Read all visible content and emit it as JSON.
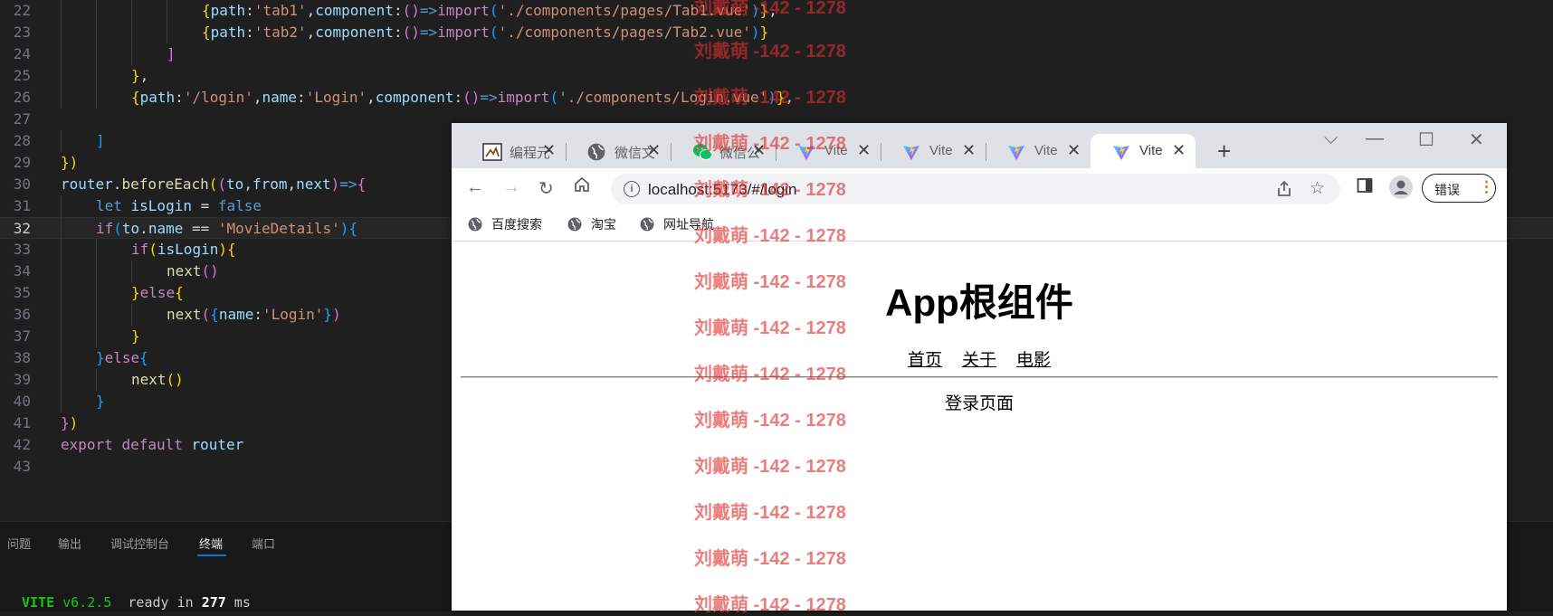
{
  "editor": {
    "lines": [
      {
        "n": "22",
        "active": false,
        "indent": 4,
        "tokens": [
          [
            "{",
            "b1"
          ],
          [
            "path",
            "key"
          ],
          [
            ":",
            "punc"
          ],
          [
            "'tab1'",
            "str"
          ],
          [
            ",",
            "punc"
          ],
          [
            "component",
            "key"
          ],
          [
            ":",
            "punc"
          ],
          [
            "()",
            "b2"
          ],
          [
            "=>",
            "kw"
          ],
          [
            "import",
            "ctl"
          ],
          [
            "(",
            "b3"
          ],
          [
            "'./components/pages/Tab1.vue'",
            "str"
          ],
          [
            ")",
            "b3"
          ],
          [
            "}",
            "b1"
          ],
          [
            ",",
            "punc"
          ]
        ]
      },
      {
        "n": "23",
        "active": false,
        "indent": 4,
        "tokens": [
          [
            "{",
            "b1"
          ],
          [
            "path",
            "key"
          ],
          [
            ":",
            "punc"
          ],
          [
            "'tab2'",
            "str"
          ],
          [
            ",",
            "punc"
          ],
          [
            "component",
            "key"
          ],
          [
            ":",
            "punc"
          ],
          [
            "()",
            "b2"
          ],
          [
            "=>",
            "kw"
          ],
          [
            "import",
            "ctl"
          ],
          [
            "(",
            "b3"
          ],
          [
            "'./components/pages/Tab2.vue'",
            "str"
          ],
          [
            ")",
            "b3"
          ],
          [
            "}",
            "b1"
          ]
        ]
      },
      {
        "n": "24",
        "active": false,
        "indent": 3,
        "tokens": [
          [
            "]",
            "b2"
          ]
        ]
      },
      {
        "n": "25",
        "active": false,
        "indent": 2,
        "tokens": [
          [
            "}",
            "b1"
          ],
          [
            ",",
            "punc"
          ]
        ]
      },
      {
        "n": "26",
        "active": false,
        "indent": 2,
        "tokens": [
          [
            "{",
            "b1"
          ],
          [
            "path",
            "key"
          ],
          [
            ":",
            "punc"
          ],
          [
            "'/login'",
            "str"
          ],
          [
            ",",
            "punc"
          ],
          [
            "name",
            "key"
          ],
          [
            ":",
            "punc"
          ],
          [
            "'Login'",
            "str"
          ],
          [
            ",",
            "punc"
          ],
          [
            "component",
            "key"
          ],
          [
            ":",
            "punc"
          ],
          [
            "()",
            "b2"
          ],
          [
            "=>",
            "kw"
          ],
          [
            "import",
            "ctl"
          ],
          [
            "(",
            "b3"
          ],
          [
            "'./components/Login.vue'",
            "str"
          ],
          [
            ")",
            "b3"
          ],
          [
            "}",
            "b1"
          ],
          [
            ",",
            "punc"
          ]
        ]
      },
      {
        "n": "27",
        "active": false,
        "indent": 0,
        "tokens": []
      },
      {
        "n": "28",
        "active": false,
        "indent": 1,
        "tokens": [
          [
            "]",
            "b3"
          ]
        ]
      },
      {
        "n": "29",
        "active": false,
        "indent": 0,
        "tokens": [
          [
            "})",
            "b1"
          ]
        ]
      },
      {
        "n": "30",
        "active": false,
        "indent": 0,
        "tokens": [
          [
            "router",
            "var"
          ],
          [
            ".",
            "punc"
          ],
          [
            "beforeEach",
            "fn"
          ],
          [
            "(",
            "b1"
          ],
          [
            "(",
            "b2"
          ],
          [
            "to",
            "var"
          ],
          [
            ",",
            "punc"
          ],
          [
            "from",
            "var"
          ],
          [
            ",",
            "punc"
          ],
          [
            "next",
            "var"
          ],
          [
            ")",
            "b2"
          ],
          [
            "=>",
            "kw"
          ],
          [
            "{",
            "b2"
          ]
        ]
      },
      {
        "n": "31",
        "active": false,
        "indent": 1,
        "tokens": [
          [
            "let ",
            "kw"
          ],
          [
            "isLogin",
            "var"
          ],
          [
            " = ",
            "op"
          ],
          [
            "false",
            "kw"
          ]
        ]
      },
      {
        "n": "32",
        "active": true,
        "indent": 1,
        "tokens": [
          [
            "if",
            "ctl"
          ],
          [
            "(",
            "b3"
          ],
          [
            "to",
            "var"
          ],
          [
            ".",
            "punc"
          ],
          [
            "name",
            "var"
          ],
          [
            " == ",
            "op"
          ],
          [
            "'MovieDetails'",
            "str"
          ],
          [
            ")",
            "b3"
          ],
          [
            "{",
            "b3"
          ]
        ]
      },
      {
        "n": "33",
        "active": false,
        "indent": 2,
        "tokens": [
          [
            "if",
            "ctl"
          ],
          [
            "(",
            "b1"
          ],
          [
            "isLogin",
            "var"
          ],
          [
            ")",
            "b1"
          ],
          [
            "{",
            "b1"
          ]
        ]
      },
      {
        "n": "34",
        "active": false,
        "indent": 3,
        "tokens": [
          [
            "next",
            "fn"
          ],
          [
            "()",
            "b2"
          ]
        ]
      },
      {
        "n": "35",
        "active": false,
        "indent": 2,
        "tokens": [
          [
            "}",
            "b1"
          ],
          [
            "else",
            "ctl"
          ],
          [
            "{",
            "b1"
          ]
        ]
      },
      {
        "n": "36",
        "active": false,
        "indent": 3,
        "tokens": [
          [
            "next",
            "fn"
          ],
          [
            "(",
            "b2"
          ],
          [
            "{",
            "b3"
          ],
          [
            "name",
            "key"
          ],
          [
            ":",
            "punc"
          ],
          [
            "'Login'",
            "str"
          ],
          [
            "}",
            "b3"
          ],
          [
            ")",
            "b2"
          ]
        ]
      },
      {
        "n": "37",
        "active": false,
        "indent": 2,
        "tokens": [
          [
            "}",
            "b1"
          ]
        ]
      },
      {
        "n": "38",
        "active": false,
        "indent": 1,
        "tokens": [
          [
            "}",
            "b3"
          ],
          [
            "else",
            "ctl"
          ],
          [
            "{",
            "b3"
          ]
        ]
      },
      {
        "n": "39",
        "active": false,
        "indent": 2,
        "tokens": [
          [
            "next",
            "fn"
          ],
          [
            "()",
            "b1"
          ]
        ]
      },
      {
        "n": "40",
        "active": false,
        "indent": 1,
        "tokens": [
          [
            "}",
            "b3"
          ]
        ]
      },
      {
        "n": "41",
        "active": false,
        "indent": 0,
        "tokens": [
          [
            "}",
            "b2"
          ],
          [
            ")",
            "b1"
          ]
        ]
      },
      {
        "n": "42",
        "active": false,
        "indent": 0,
        "tokens": [
          [
            "export ",
            "ctl"
          ],
          [
            "default ",
            "ctl"
          ],
          [
            "router",
            "var"
          ]
        ]
      },
      {
        "n": "43",
        "active": false,
        "indent": 0,
        "tokens": []
      }
    ]
  },
  "panel": {
    "tabs": [
      {
        "label": "问题",
        "active": false
      },
      {
        "label": "输出",
        "active": false
      },
      {
        "label": "调试控制台",
        "active": false
      },
      {
        "label": "终端",
        "active": true
      },
      {
        "label": "端口",
        "active": false
      }
    ],
    "terminal": {
      "app": "VITE",
      "version": "v6.2.5",
      "ready": "ready in ",
      "ms_value": "277",
      "ms_unit": " ms"
    }
  },
  "browser": {
    "tabs": [
      {
        "label": "编程元",
        "icon": "code-site-icon",
        "active": false
      },
      {
        "label": "微信文",
        "icon": "globe-icon",
        "active": false
      },
      {
        "label": "微信公",
        "icon": "wechat-icon",
        "active": false
      },
      {
        "label": "Vite",
        "icon": "vite-icon",
        "active": false
      },
      {
        "label": "Vite",
        "icon": "vite-icon",
        "active": false
      },
      {
        "label": "Vite",
        "icon": "vite-icon",
        "active": false
      },
      {
        "label": "Vite",
        "icon": "vite-icon",
        "active": true
      }
    ],
    "url": "localhost:5173/#/login",
    "error_button": "错误",
    "bookmarks": [
      "百度搜索",
      "淘宝",
      "网址导航"
    ],
    "page": {
      "title": "App根组件",
      "nav": [
        "首页",
        "关于",
        "电影"
      ],
      "content": "登录页面"
    }
  },
  "watermark": {
    "text": "刘戴萌 -142 - 1278",
    "color": "#de2d2d"
  }
}
